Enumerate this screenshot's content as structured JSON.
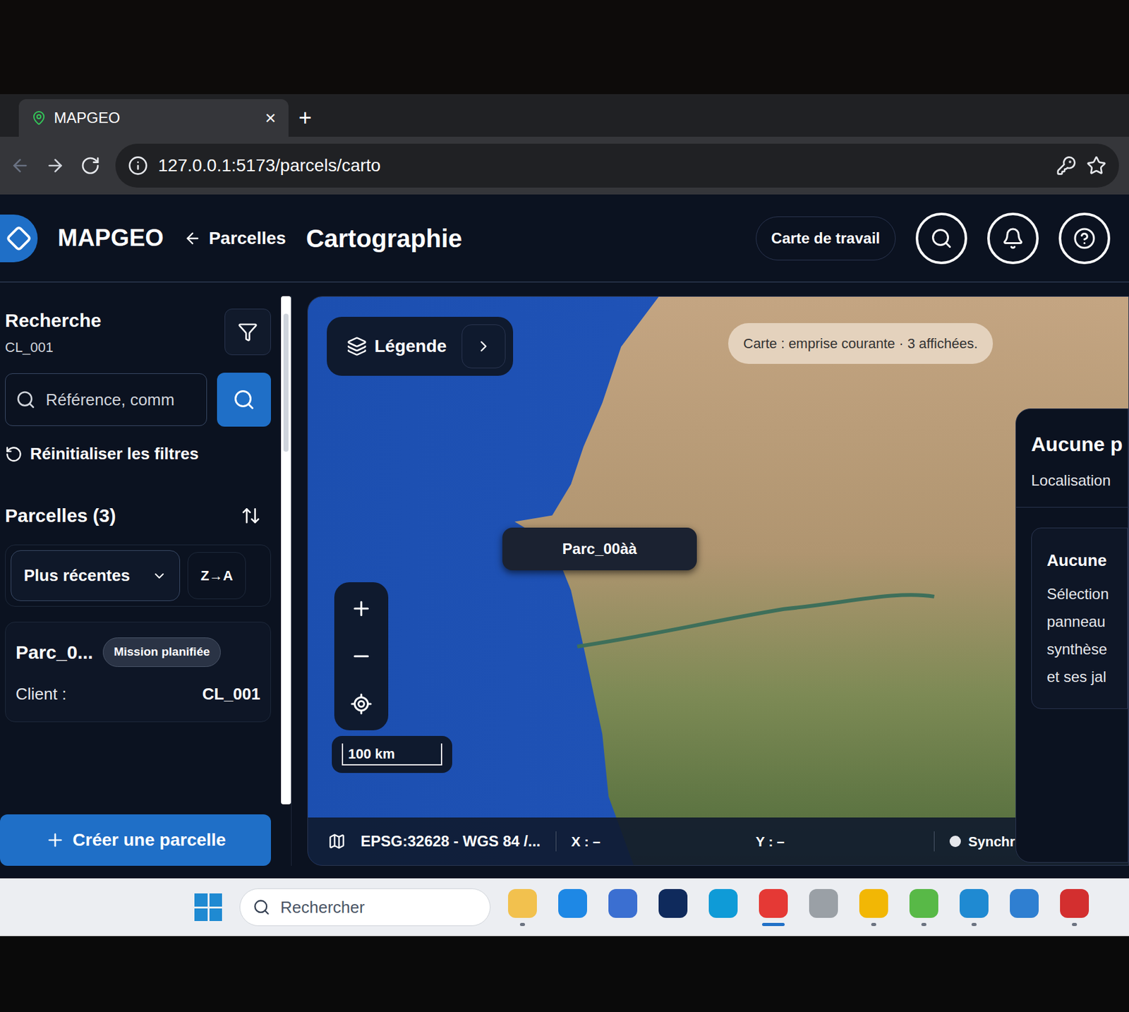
{
  "browser": {
    "tab": {
      "title": "MAPGEO",
      "close": "×"
    },
    "new_tab": "+",
    "url": "127.0.0.1:5173/parcels/carto"
  },
  "header": {
    "brand": "MAPGEO",
    "back": "Parcelles",
    "title": "Cartographie",
    "work_map": "Carte de travail"
  },
  "sidebar": {
    "title": "Recherche",
    "subtitle": "CL_001",
    "search_placeholder": "Référence, comm",
    "reset": "Réinitialiser les filtres",
    "list_title": "Parcelles (3)",
    "sort": "Plus récentes",
    "order": "Z→A",
    "parcels": [
      {
        "name": "Parc_0...",
        "status": "Mission planifiée",
        "client_label": "Client :",
        "client": "CL_001"
      }
    ],
    "create": "Créer une parcelle"
  },
  "map": {
    "legend": "Légende",
    "info": "Carte : emprise courante · 3 affichées.",
    "markers": [
      {
        "label": "Parc_00àà"
      }
    ],
    "scale": "100 km",
    "crs": "EPSG:32628 - WGS 84 /...",
    "x": "X : –",
    "y": "Y : –",
    "sync": "Synchr"
  },
  "details": {
    "title": "Aucune p",
    "subtitle": "Localisation",
    "card_title": "Aucune",
    "card_lines": [
      "Sélection",
      "panneau",
      "synthèse",
      "et ses jal"
    ]
  },
  "taskbar": {
    "search": "Rechercher",
    "apps": [
      {
        "name": "explorer",
        "running": true,
        "active": false,
        "color": "#f2c14e"
      },
      {
        "name": "app-blue",
        "running": false,
        "active": false,
        "color": "#1e88e5"
      },
      {
        "name": "document",
        "running": false,
        "active": false,
        "color": "#3b6fd1"
      },
      {
        "name": "ring",
        "running": false,
        "active": false,
        "color": "#0f2a5c"
      },
      {
        "name": "edge",
        "running": false,
        "active": false,
        "color": "#0f9bd7"
      },
      {
        "name": "chrome",
        "running": true,
        "active": true,
        "color": "#e53935"
      },
      {
        "name": "emoji",
        "running": false,
        "active": false,
        "color": "#9aa0a6"
      },
      {
        "name": "power-bi",
        "running": true,
        "active": false,
        "color": "#f2b705"
      },
      {
        "name": "qgis",
        "running": true,
        "active": false,
        "color": "#58b947"
      },
      {
        "name": "vscode",
        "running": true,
        "active": false,
        "color": "#1f8ad2"
      },
      {
        "name": "cube",
        "running": false,
        "active": false,
        "color": "#2f7fd1"
      },
      {
        "name": "acrobat",
        "running": true,
        "active": false,
        "color": "#d32f2f"
      }
    ]
  }
}
